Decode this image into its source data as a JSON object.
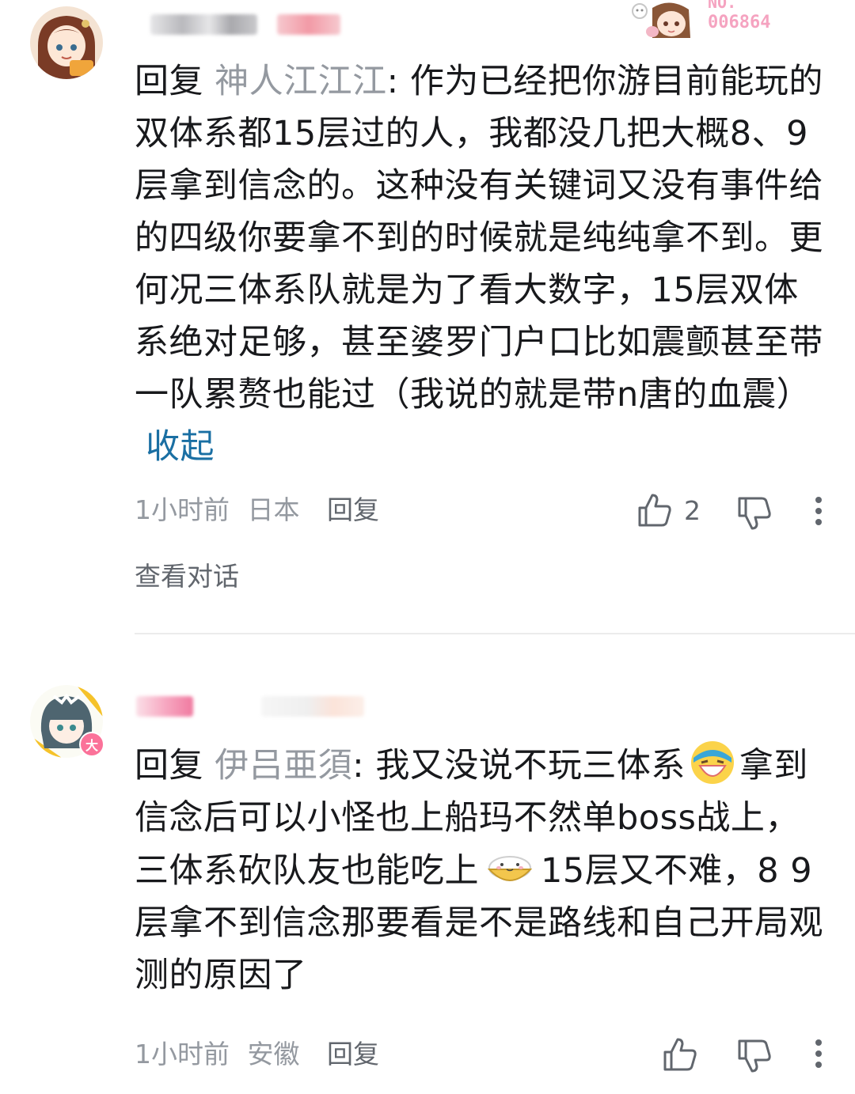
{
  "comments": [
    {
      "badge": {
        "label": "NO.",
        "number": "006864"
      },
      "reply_prefix": "回复 ",
      "reply_target": "神人江江江",
      "text": ": 作为已经把你游目前能玩的双体系都15层过的人，我都没几把大概8、9层拿到信念的。这种没有关键词又没有事件给的四级你要拿不到的时候就是纯纯拿不到。更何况三体系队就是为了看大数字，15层双体系绝对足够，甚至婆罗门户口比如震颤甚至带一队累赘也能过（我说的就是带n唐的血震）",
      "collapse_label": "收起",
      "time": "1小时前",
      "location": "日本",
      "reply_label": "回复",
      "like_count": "2",
      "view_conversation": "查看对话"
    },
    {
      "level_badge": "大",
      "reply_prefix": "回复 ",
      "reply_target": "伊吕亜須",
      "text_part1": ": 我又没说不玩三体系",
      "text_part2": "拿到信念后可以小怪也上船玛不然单boss战上，三体系砍队友也能吃上",
      "text_part3": "15层又不难，8 9层拿不到信念那要看是不是路线和自己开局观测的原因了",
      "time": "1小时前",
      "location": "安徽",
      "reply_label": "回复"
    }
  ],
  "colors": {
    "link": "#1a6fa3",
    "muted": "#9499a0",
    "text": "#18191c",
    "pink": "#fb7299"
  }
}
